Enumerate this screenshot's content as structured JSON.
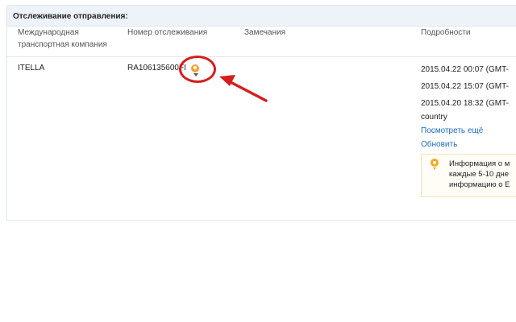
{
  "panel": {
    "title": "Отслеживание отправления:"
  },
  "columns": {
    "carrier": [
      "Международная",
      "транспортная компания"
    ],
    "tracking": "Номер отслеживания",
    "notes": "Замечания",
    "details": "Подробности"
  },
  "row": {
    "carrier": "ITELLA",
    "tracking_number": "RA106135600FI",
    "details": {
      "events": [
        "2015.04.22 00:07 (GMT-",
        "2015.04.22 15:07 (GMT-",
        "2015.04.20 18:32 (GMT-"
      ],
      "extra": "country",
      "more_link": "Посмотреть ещё",
      "refresh_link": "Обновить"
    }
  },
  "info": {
    "lines": [
      "Информация о м",
      "каждые 5-10 дне",
      "информацию о Е"
    ]
  },
  "colors": {
    "link": "#1a6bc9",
    "header_bg": "#eef3f9",
    "annotation": "#d61e1e",
    "tracking_icon": "#f2a33a"
  },
  "icons": {
    "tracking": "location-pin-icon",
    "info": "lightbulb-icon",
    "annotation": "red-arrow-icon"
  }
}
